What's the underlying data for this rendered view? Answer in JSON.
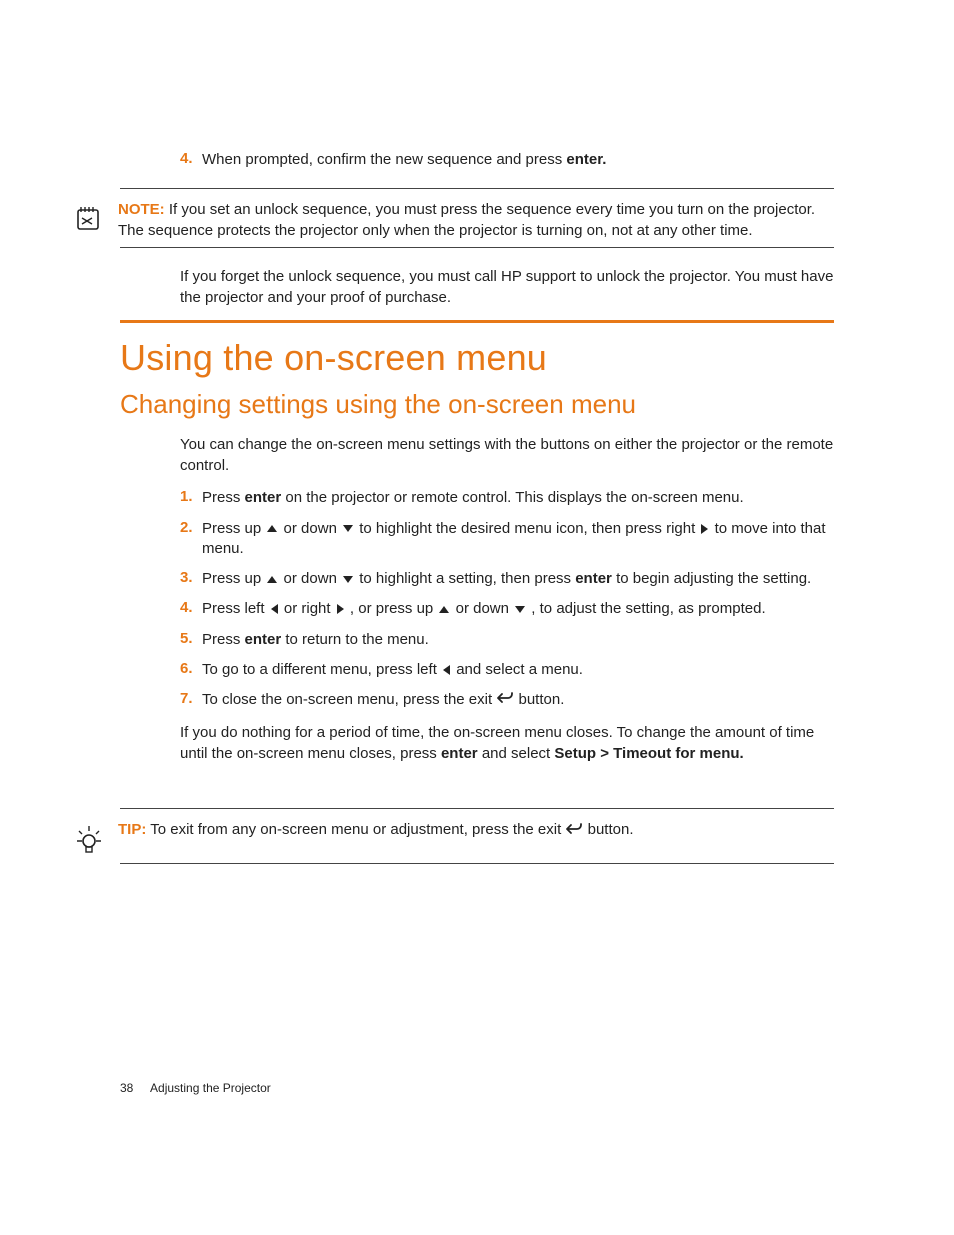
{
  "pretext_step": {
    "num": "4.",
    "prefix": "When prompted, confirm the new sequence and press ",
    "bold": "enter."
  },
  "note": {
    "label": "NOTE:",
    "text": "If you set an unlock sequence, you must press the sequence every time you turn on the projector. The sequence protects the projector only when the projector is turning on, not at any other time."
  },
  "forgot_para": "If you forget the unlock sequence, you must call HP support to unlock the projector. You must have the projector and your proof of purchase.",
  "h1": "Using the on-screen menu",
  "h2": "Changing settings using the on-screen menu",
  "intro_para": "You can change the on-screen menu settings with the buttons on either the projector or the remote control.",
  "steps": {
    "s1": {
      "num": "1.",
      "a": "Press ",
      "b": "enter",
      "c": " on the projector or remote control. This displays the on-screen menu."
    },
    "s2": {
      "num": "2.",
      "a": "Press up ",
      "b": " or down ",
      "c": " to highlight the desired menu icon, then press right ",
      "d": " to move into that menu."
    },
    "s3": {
      "num": "3.",
      "a": "Press up ",
      "b": " or down ",
      "c": " to highlight a setting, then press ",
      "d": "enter",
      "e": " to begin adjusting the setting."
    },
    "s4": {
      "num": "4.",
      "a": "Press left ",
      "b": " or right ",
      "c": " , or press up ",
      "d": " or down ",
      "e": " , to adjust the setting, as prompted."
    },
    "s5": {
      "num": "5.",
      "a": "Press ",
      "b": "enter",
      "c": " to return to the menu."
    },
    "s6": {
      "num": "6.",
      "a": "To go to a different menu, press left ",
      "b": " and select a menu."
    },
    "s7": {
      "num": "7.",
      "a": "To close the on-screen menu, press the exit ",
      "b": " button."
    }
  },
  "timeout_para": {
    "a": "If you do nothing for a period of time, the on-screen menu closes. To change the amount of time until the on-screen menu closes, press ",
    "b": "enter",
    "c": " and select ",
    "d": "Setup > Timeout for menu."
  },
  "tip": {
    "label": "TIP:",
    "a": "To exit from any on-screen menu or adjustment, press the exit ",
    "b": " button."
  },
  "footer": {
    "page": "38",
    "section": "Adjusting the Projector"
  }
}
